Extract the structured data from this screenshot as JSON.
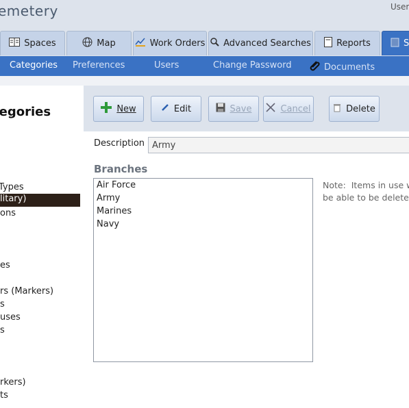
{
  "app": {
    "title": "emetery",
    "user_label": "User"
  },
  "tabs": [
    {
      "label": "Spaces",
      "icon": "book-icon"
    },
    {
      "label": "Map",
      "icon": "globe-icon"
    },
    {
      "label": "Work Orders",
      "icon": "chart-icon"
    },
    {
      "label": "Advanced Searches",
      "icon": "search-icon"
    },
    {
      "label": "Reports",
      "icon": "document-icon"
    },
    {
      "label": "S",
      "icon": "settings-icon",
      "active": true
    }
  ],
  "subnav": {
    "items": [
      "Categories",
      "Preferences",
      "Users",
      "Change Password"
    ],
    "documents_label": "Documents",
    "active": "Categories"
  },
  "sidebar": {
    "title": "tegories",
    "items": [
      "Types",
      "litary)",
      "ons",
      "es",
      "rs (Markers)",
      "s",
      "uses",
      "s",
      "rkers)",
      "ts"
    ],
    "selected_index": 1
  },
  "toolbar": {
    "new_label": "New",
    "edit_label": "Edit",
    "save_label": "Save",
    "cancel_label": "Cancel",
    "delete_label": "Delete"
  },
  "form": {
    "description_label": "Description",
    "description_value": "Army",
    "branches_title": "Branches",
    "branches": [
      "Air Force",
      "Army",
      "Marines",
      "Navy"
    ],
    "note": "Note:  Items in use w\nbe able to be delete"
  },
  "colors": {
    "nav_blue": "#3a72c4",
    "tab_bg": "#c5d3e8",
    "selected_row": "#2d2018",
    "add_green": "#2e9a3a"
  }
}
